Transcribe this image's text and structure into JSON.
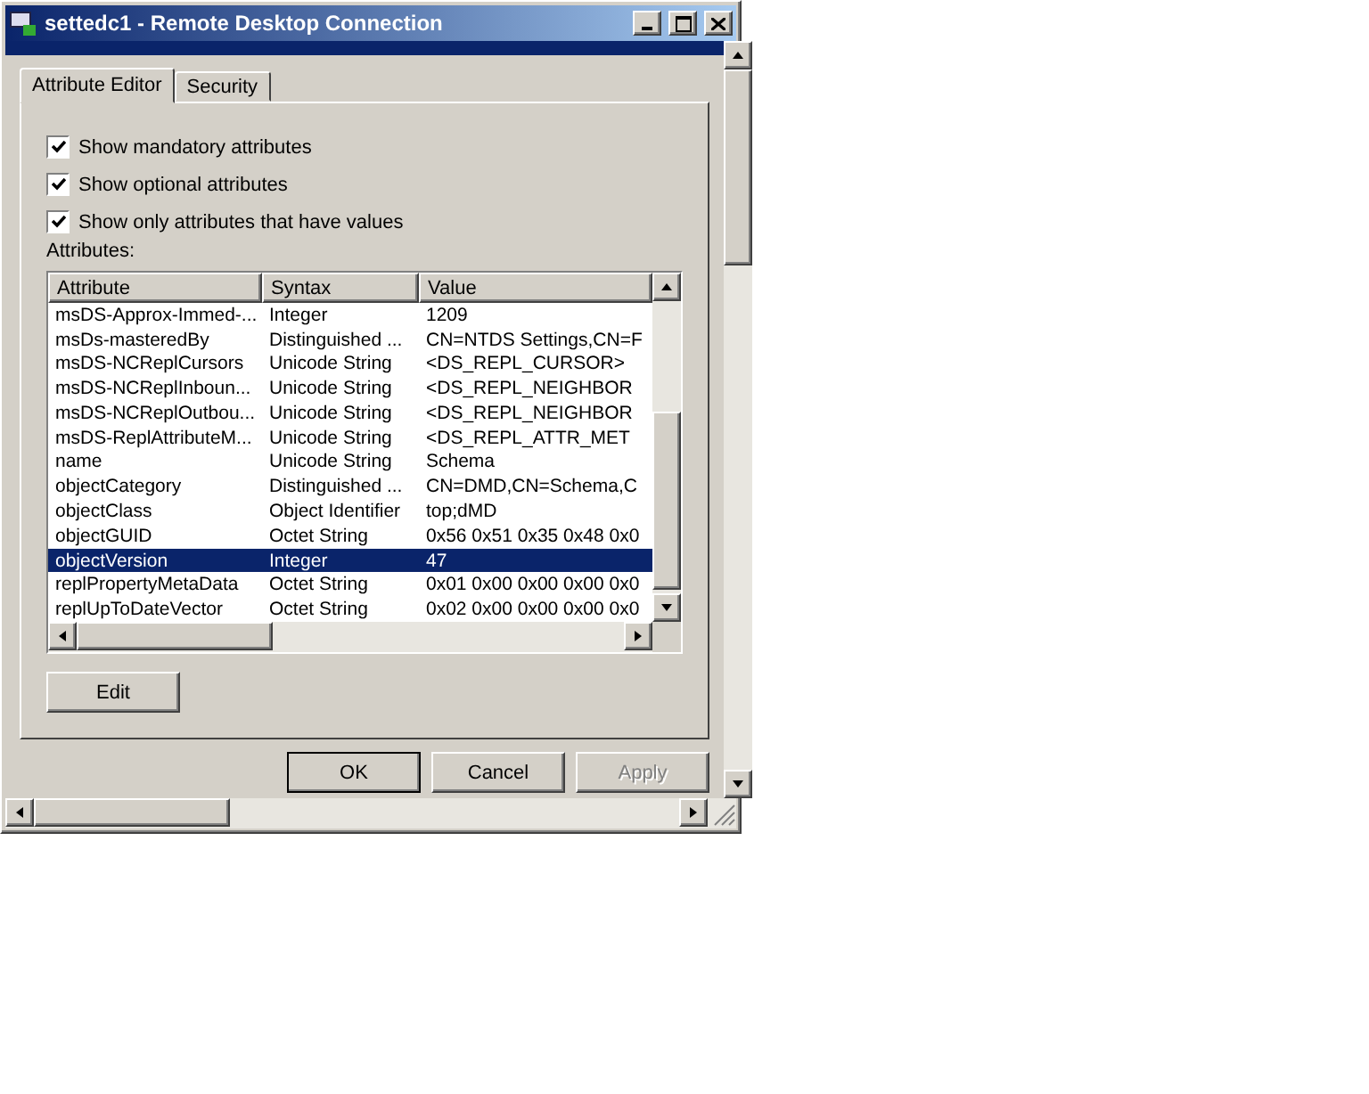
{
  "window": {
    "title": "settedc1 - Remote Desktop Connection"
  },
  "tabs": [
    {
      "label": "Attribute Editor",
      "selected": true
    },
    {
      "label": "Security",
      "selected": false
    }
  ],
  "options": [
    {
      "label": "Show mandatory attributes",
      "checked": true
    },
    {
      "label": "Show optional attributes",
      "checked": true
    },
    {
      "label": "Show only attributes that have values",
      "checked": true
    }
  ],
  "attributes_label": "Attributes:",
  "table": {
    "columns": [
      "Attribute",
      "Syntax",
      "Value"
    ],
    "rows": [
      {
        "cells": [
          "msDS-Approx-Immed-...",
          "Integer",
          "1209"
        ],
        "selected": false
      },
      {
        "cells": [
          "msDs-masteredBy",
          "Distinguished ...",
          "CN=NTDS Settings,CN=F"
        ],
        "selected": false
      },
      {
        "cells": [
          "msDS-NCReplCursors",
          "Unicode String",
          "<DS_REPL_CURSOR>"
        ],
        "selected": false
      },
      {
        "cells": [
          "msDS-NCReplInboun...",
          "Unicode String",
          "<DS_REPL_NEIGHBOR"
        ],
        "selected": false
      },
      {
        "cells": [
          "msDS-NCReplOutbou...",
          "Unicode String",
          "<DS_REPL_NEIGHBOR"
        ],
        "selected": false
      },
      {
        "cells": [
          "msDS-ReplAttributeM...",
          "Unicode String",
          "<DS_REPL_ATTR_MET"
        ],
        "selected": false
      },
      {
        "cells": [
          "name",
          "Unicode String",
          "Schema"
        ],
        "selected": false
      },
      {
        "cells": [
          "objectCategory",
          "Distinguished ...",
          "CN=DMD,CN=Schema,C"
        ],
        "selected": false
      },
      {
        "cells": [
          "objectClass",
          "Object Identifier",
          "top;dMD"
        ],
        "selected": false
      },
      {
        "cells": [
          "objectGUID",
          "Octet String",
          "0x56 0x51 0x35 0x48 0x0"
        ],
        "selected": false
      },
      {
        "cells": [
          "objectVersion",
          "Integer",
          "47"
        ],
        "selected": true
      },
      {
        "cells": [
          "replPropertyMetaData",
          "Octet String",
          "0x01 0x00 0x00 0x00 0x0"
        ],
        "selected": false
      },
      {
        "cells": [
          "replUpToDateVector",
          "Octet String",
          "0x02 0x00 0x00 0x00 0x0"
        ],
        "selected": false
      }
    ]
  },
  "edit_button": "Edit",
  "buttons": [
    {
      "label": "OK",
      "default": true,
      "disabled": false
    },
    {
      "label": "Cancel",
      "default": false,
      "disabled": false
    },
    {
      "label": "Apply",
      "default": false,
      "disabled": true
    }
  ]
}
